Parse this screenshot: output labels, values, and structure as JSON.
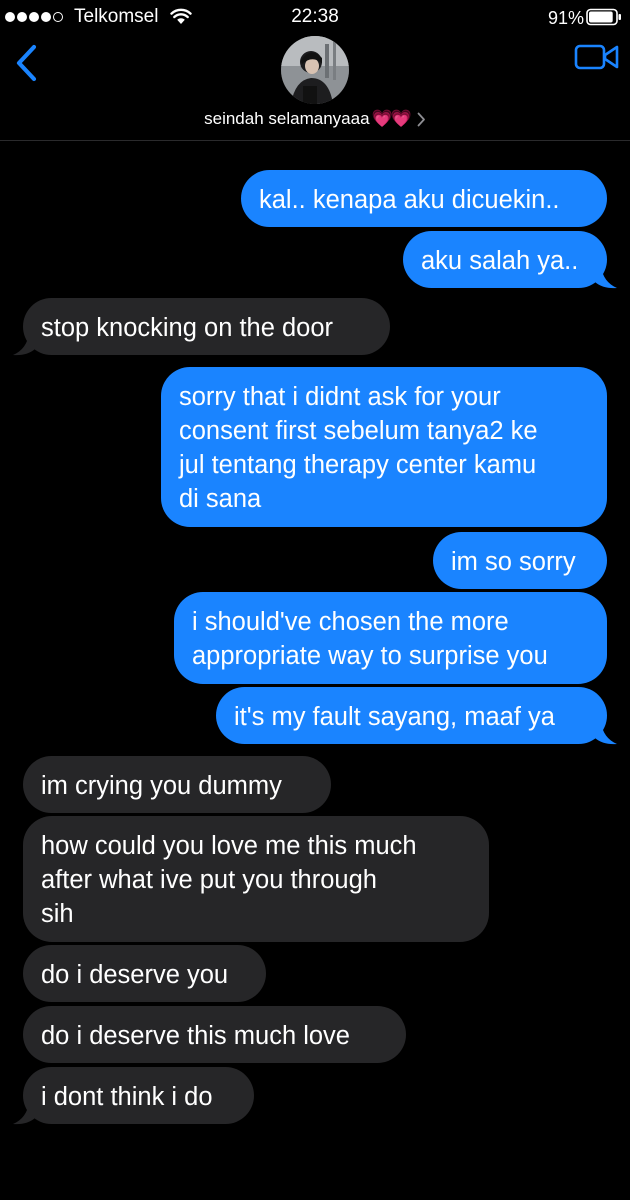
{
  "status_bar": {
    "carrier": "Telkomsel",
    "time": "22:38",
    "battery": "91%",
    "battery_level": 0.91,
    "signal_bars": 4
  },
  "header": {
    "contact_name": "seindah selamanyaaa",
    "contact_emoji": "💗💗",
    "back_icon": "chevron-left-icon",
    "video_icon": "video-camera-icon",
    "accent_color": "#1a84ff"
  },
  "colors": {
    "sent_bubble": "#1a84ff",
    "received_bubble": "#262628",
    "background": "#000000"
  },
  "messages": [
    {
      "from": "me",
      "text": "kal.. kenapa aku dicuekin.."
    },
    {
      "from": "me",
      "text": "aku salah ya.."
    },
    {
      "from": "them",
      "text": "stop knocking on the door"
    },
    {
      "from": "me",
      "text": "sorry that i didnt ask for your\nconsent first sebelum tanya2 ke\njul tentang therapy center kamu\ndi sana"
    },
    {
      "from": "me",
      "text": "im so sorry"
    },
    {
      "from": "me",
      "text": "i should've chosen the more\nappropriate way to surprise you"
    },
    {
      "from": "me",
      "text": "it's my fault sayang, maaf ya"
    },
    {
      "from": "them",
      "text": "im crying you dummy"
    },
    {
      "from": "them",
      "text": "how could you love me this much\nafter what ive put you through\nsih"
    },
    {
      "from": "them",
      "text": "do i deserve you"
    },
    {
      "from": "them",
      "text": "do i deserve this much love"
    },
    {
      "from": "them",
      "text": "i dont think i do"
    }
  ]
}
